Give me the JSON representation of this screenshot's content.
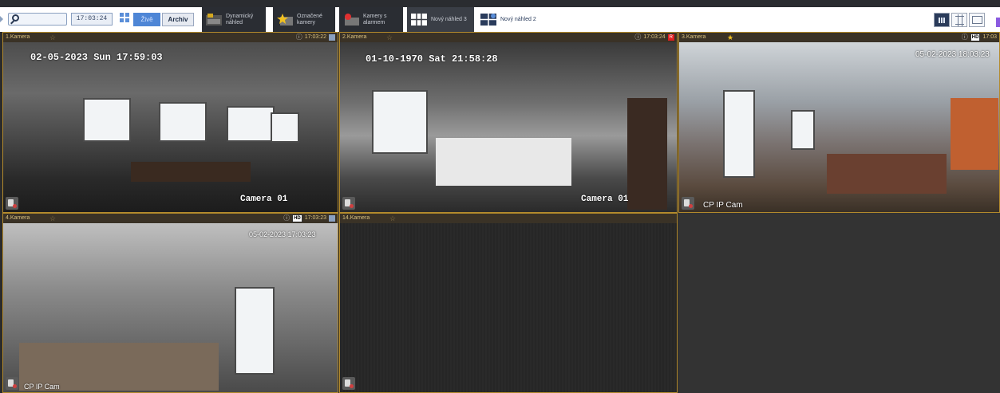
{
  "toolbar": {
    "time": "17:03:24",
    "live_label": "Živě",
    "archive_label": "Archiv",
    "tabs": [
      {
        "label": "Dynamický\nnáhled",
        "icon": "dynamic-view-icon"
      },
      {
        "label": "Označené\nkamery",
        "icon": "star-icon"
      },
      {
        "label": "Kamery s\nalarmem",
        "icon": "alarm-camera-icon"
      },
      {
        "label": "Nový náhled 3",
        "icon": "grid-layout-icon"
      },
      {
        "label": "Nový náhled 2",
        "icon": "grid-layout-icon"
      }
    ]
  },
  "cameras": [
    {
      "name": "1.Kamera",
      "time": "17:03:22",
      "osd_timestamp": "02-05-2023 Sun 17:59:03",
      "osd_name": "Camera 01"
    },
    {
      "name": "2.Kamera",
      "time": "17:03:24",
      "rec": "R",
      "osd_timestamp": "01-10-1970 Sat 21:58:28",
      "osd_name": "Camera 01"
    },
    {
      "name": "3.Kamera",
      "hd": "HD",
      "time": "17:03",
      "osd_timestamp": "05-02-2023 18:03:23",
      "osd_name": "CP IP Cam"
    },
    {
      "name": "4.Kamera",
      "hd": "HD",
      "time": "17:03:23",
      "osd_timestamp": "05-02-2023 17:03:23",
      "osd_name": "CP IP Cam"
    },
    {
      "name": "14.Kamera"
    }
  ],
  "colors": {
    "tile_border": "#b38a2c",
    "header_bg": "#3a3226",
    "toolbar_bg": "#2a2c30",
    "live_button": "#4e86d6"
  }
}
